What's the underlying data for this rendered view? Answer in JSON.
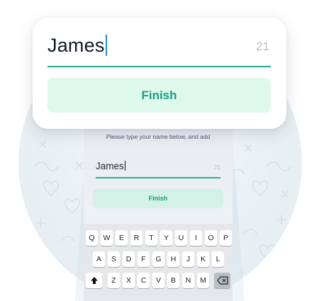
{
  "card": {
    "name_value": "James",
    "char_count": "21",
    "finish_label": "Finish"
  },
  "phone": {
    "instructions": "Please type your name below, and add",
    "name_value": "James",
    "char_count": "21",
    "finish_label": "Finish",
    "keyboard": {
      "row1": [
        "Q",
        "W",
        "E",
        "R",
        "T",
        "Y",
        "U",
        "I",
        "O",
        "P"
      ],
      "row2": [
        "A",
        "S",
        "D",
        "F",
        "G",
        "H",
        "J",
        "K",
        "L"
      ],
      "row3": [
        "Z",
        "X",
        "C",
        "V",
        "B",
        "N",
        "M"
      ],
      "shift_icon": "shift-arrow-icon",
      "backspace_icon": "backspace-icon"
    }
  },
  "colors": {
    "accent": "#2aa79a",
    "finish_text": "#16a085",
    "finish_bg": "#dff8ec",
    "caret": "#1e88e5"
  }
}
